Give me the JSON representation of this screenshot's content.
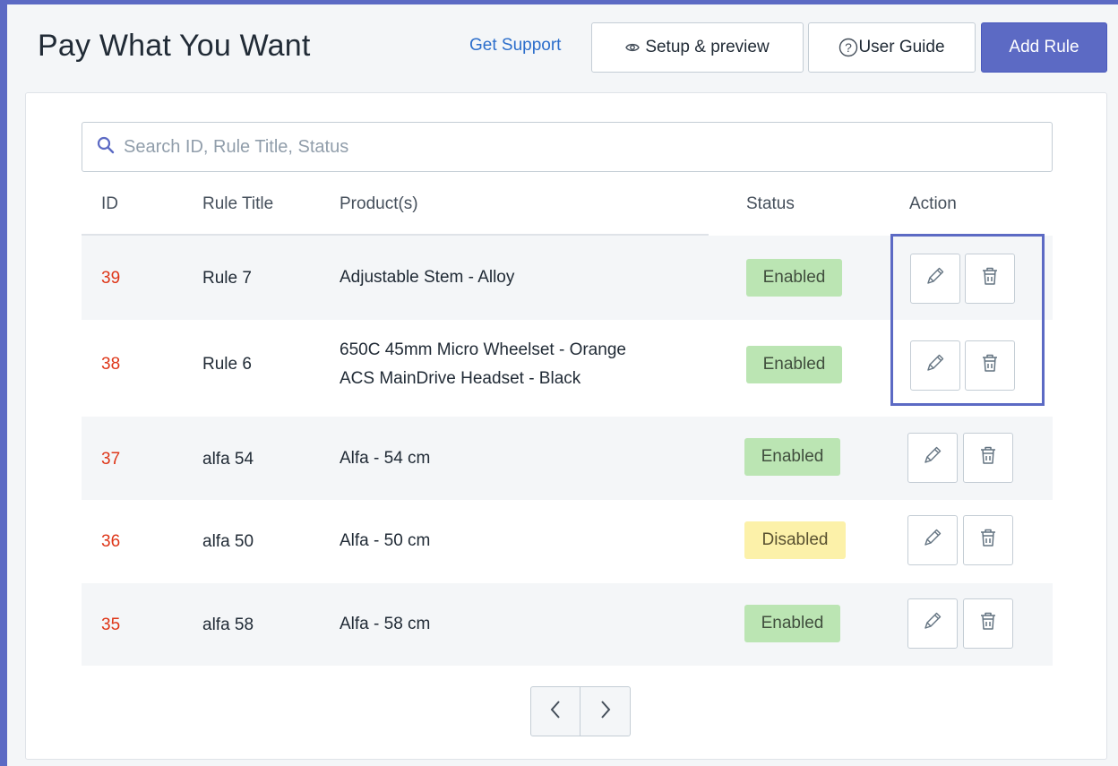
{
  "header": {
    "title": "Pay What You Want",
    "get_support": "Get Support",
    "setup_preview": "Setup & preview",
    "user_guide": "User Guide",
    "add_rule": "Add Rule"
  },
  "search": {
    "placeholder": "Search ID, Rule Title, Status",
    "value": ""
  },
  "table": {
    "headers": {
      "id": "ID",
      "rule_title": "Rule Title",
      "products": "Product(s)",
      "status": "Status",
      "action": "Action"
    },
    "rows": [
      {
        "id": "39",
        "title": "Rule 7",
        "products": [
          "Adjustable Stem - Alloy"
        ],
        "status": "Enabled"
      },
      {
        "id": "38",
        "title": "Rule 6",
        "products": [
          "650C 45mm Micro Wheelset - Orange",
          "ACS MainDrive Headset - Black"
        ],
        "status": "Enabled"
      },
      {
        "id": "37",
        "title": "alfa 54",
        "products": [
          "Alfa - 54 cm"
        ],
        "status": "Enabled"
      },
      {
        "id": "36",
        "title": "alfa 50",
        "products": [
          "Alfa - 50 cm"
        ],
        "status": "Disabled"
      },
      {
        "id": "35",
        "title": "alfa 58",
        "products": [
          "Alfa - 58 cm"
        ],
        "status": "Enabled"
      }
    ]
  },
  "icons": {
    "search": "search-icon",
    "eye": "eye-icon",
    "help": "help-circle-icon",
    "edit": "pencil-icon",
    "delete": "trash-icon",
    "prev": "chevron-left-icon",
    "next": "chevron-right-icon"
  },
  "colors": {
    "accent": "#5c6ac4",
    "link": "#2c6ecb",
    "id_text": "#de3618",
    "enabled_badge": "#bbe5b3",
    "disabled_badge": "#fcf1a9"
  }
}
